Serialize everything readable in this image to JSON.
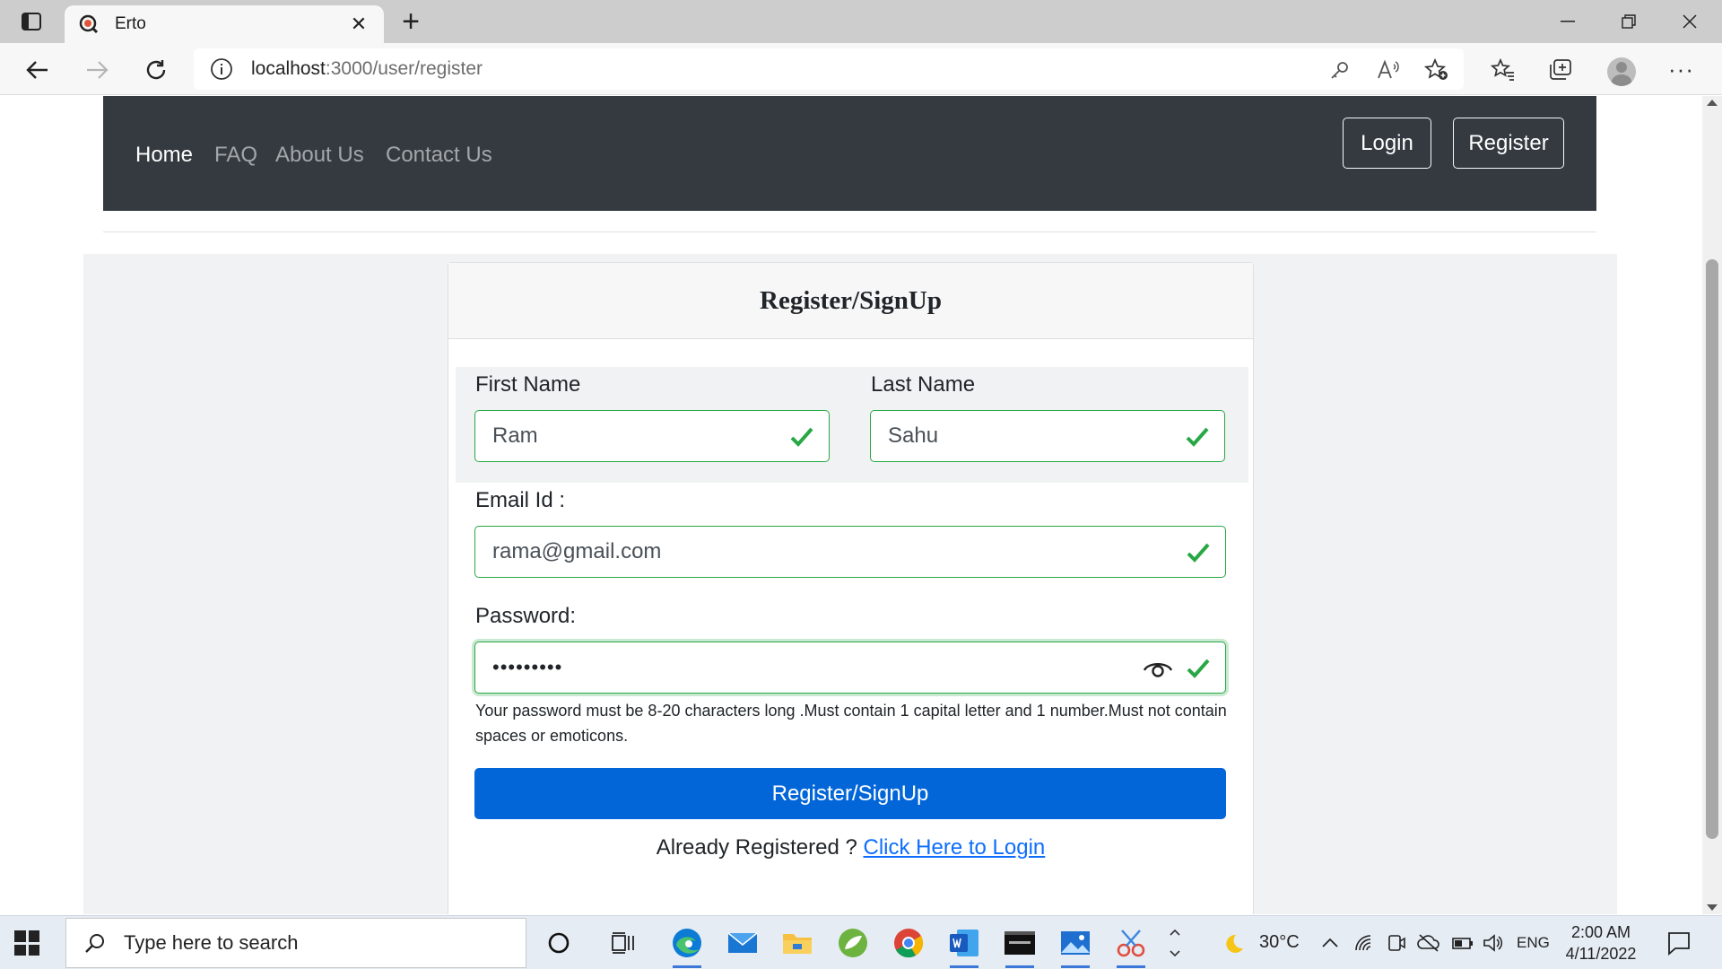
{
  "browser": {
    "tab_title": "Erto",
    "url_host": "localhost",
    "url_path": ":3000/user/register"
  },
  "navbar": {
    "links": [
      "Home",
      "FAQ",
      "About Us",
      "Contact Us"
    ],
    "login_label": "Login",
    "register_label": "Register"
  },
  "form": {
    "title": "Register/SignUp",
    "first_name_label": "First Name",
    "first_name_value": "Ram",
    "last_name_label": "Last Name",
    "last_name_value": "Sahu",
    "email_label": "Email Id :",
    "email_value": "rama@gmail.com",
    "password_label": "Password:",
    "password_value": "•••••••••",
    "password_help": "Your password must be 8-20 characters long .Must contain 1 capital letter and 1 number.Must not contain spaces or emoticons.",
    "submit_label": "Register/SignUp",
    "already_text": "Already Registered ? ",
    "login_link": "Click Here to Login"
  },
  "taskbar": {
    "search_placeholder": "Type here to search",
    "temperature": "30°C",
    "language": "ENG",
    "time": "2:00 AM",
    "date": "4/11/2022"
  },
  "colors": {
    "navbar_bg": "#343a40",
    "valid_green": "#28a745",
    "primary_blue": "#0266d8",
    "link_blue": "#0d6efd"
  }
}
